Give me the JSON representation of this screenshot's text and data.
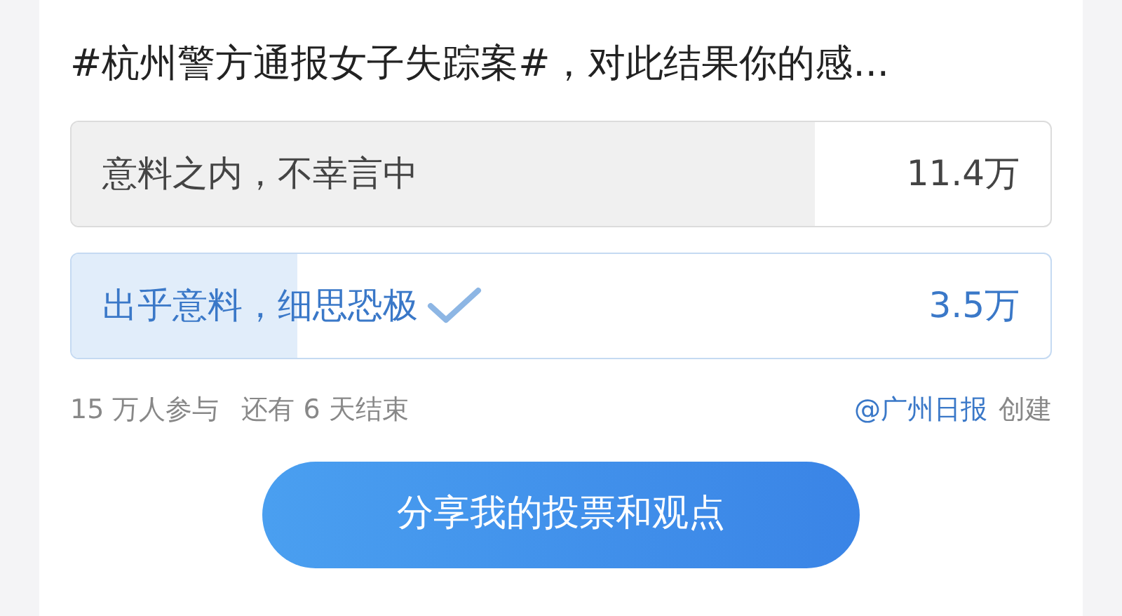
{
  "title": "#杭州警方通报女子失踪案#，对此结果你的感...",
  "options": [
    {
      "label": "意料之内，不幸言中",
      "count": "11.4万",
      "level": 0.76,
      "selected": false
    },
    {
      "label": "出乎意料，细思恐极",
      "count": "3.5万",
      "level": 0.23,
      "selected": true
    }
  ],
  "footer": {
    "participants": "15 万人参与",
    "remaining": "还有 6 天结束",
    "author": "@广州日报",
    "created": "创建"
  },
  "share_button": "分享我的投票和观点"
}
